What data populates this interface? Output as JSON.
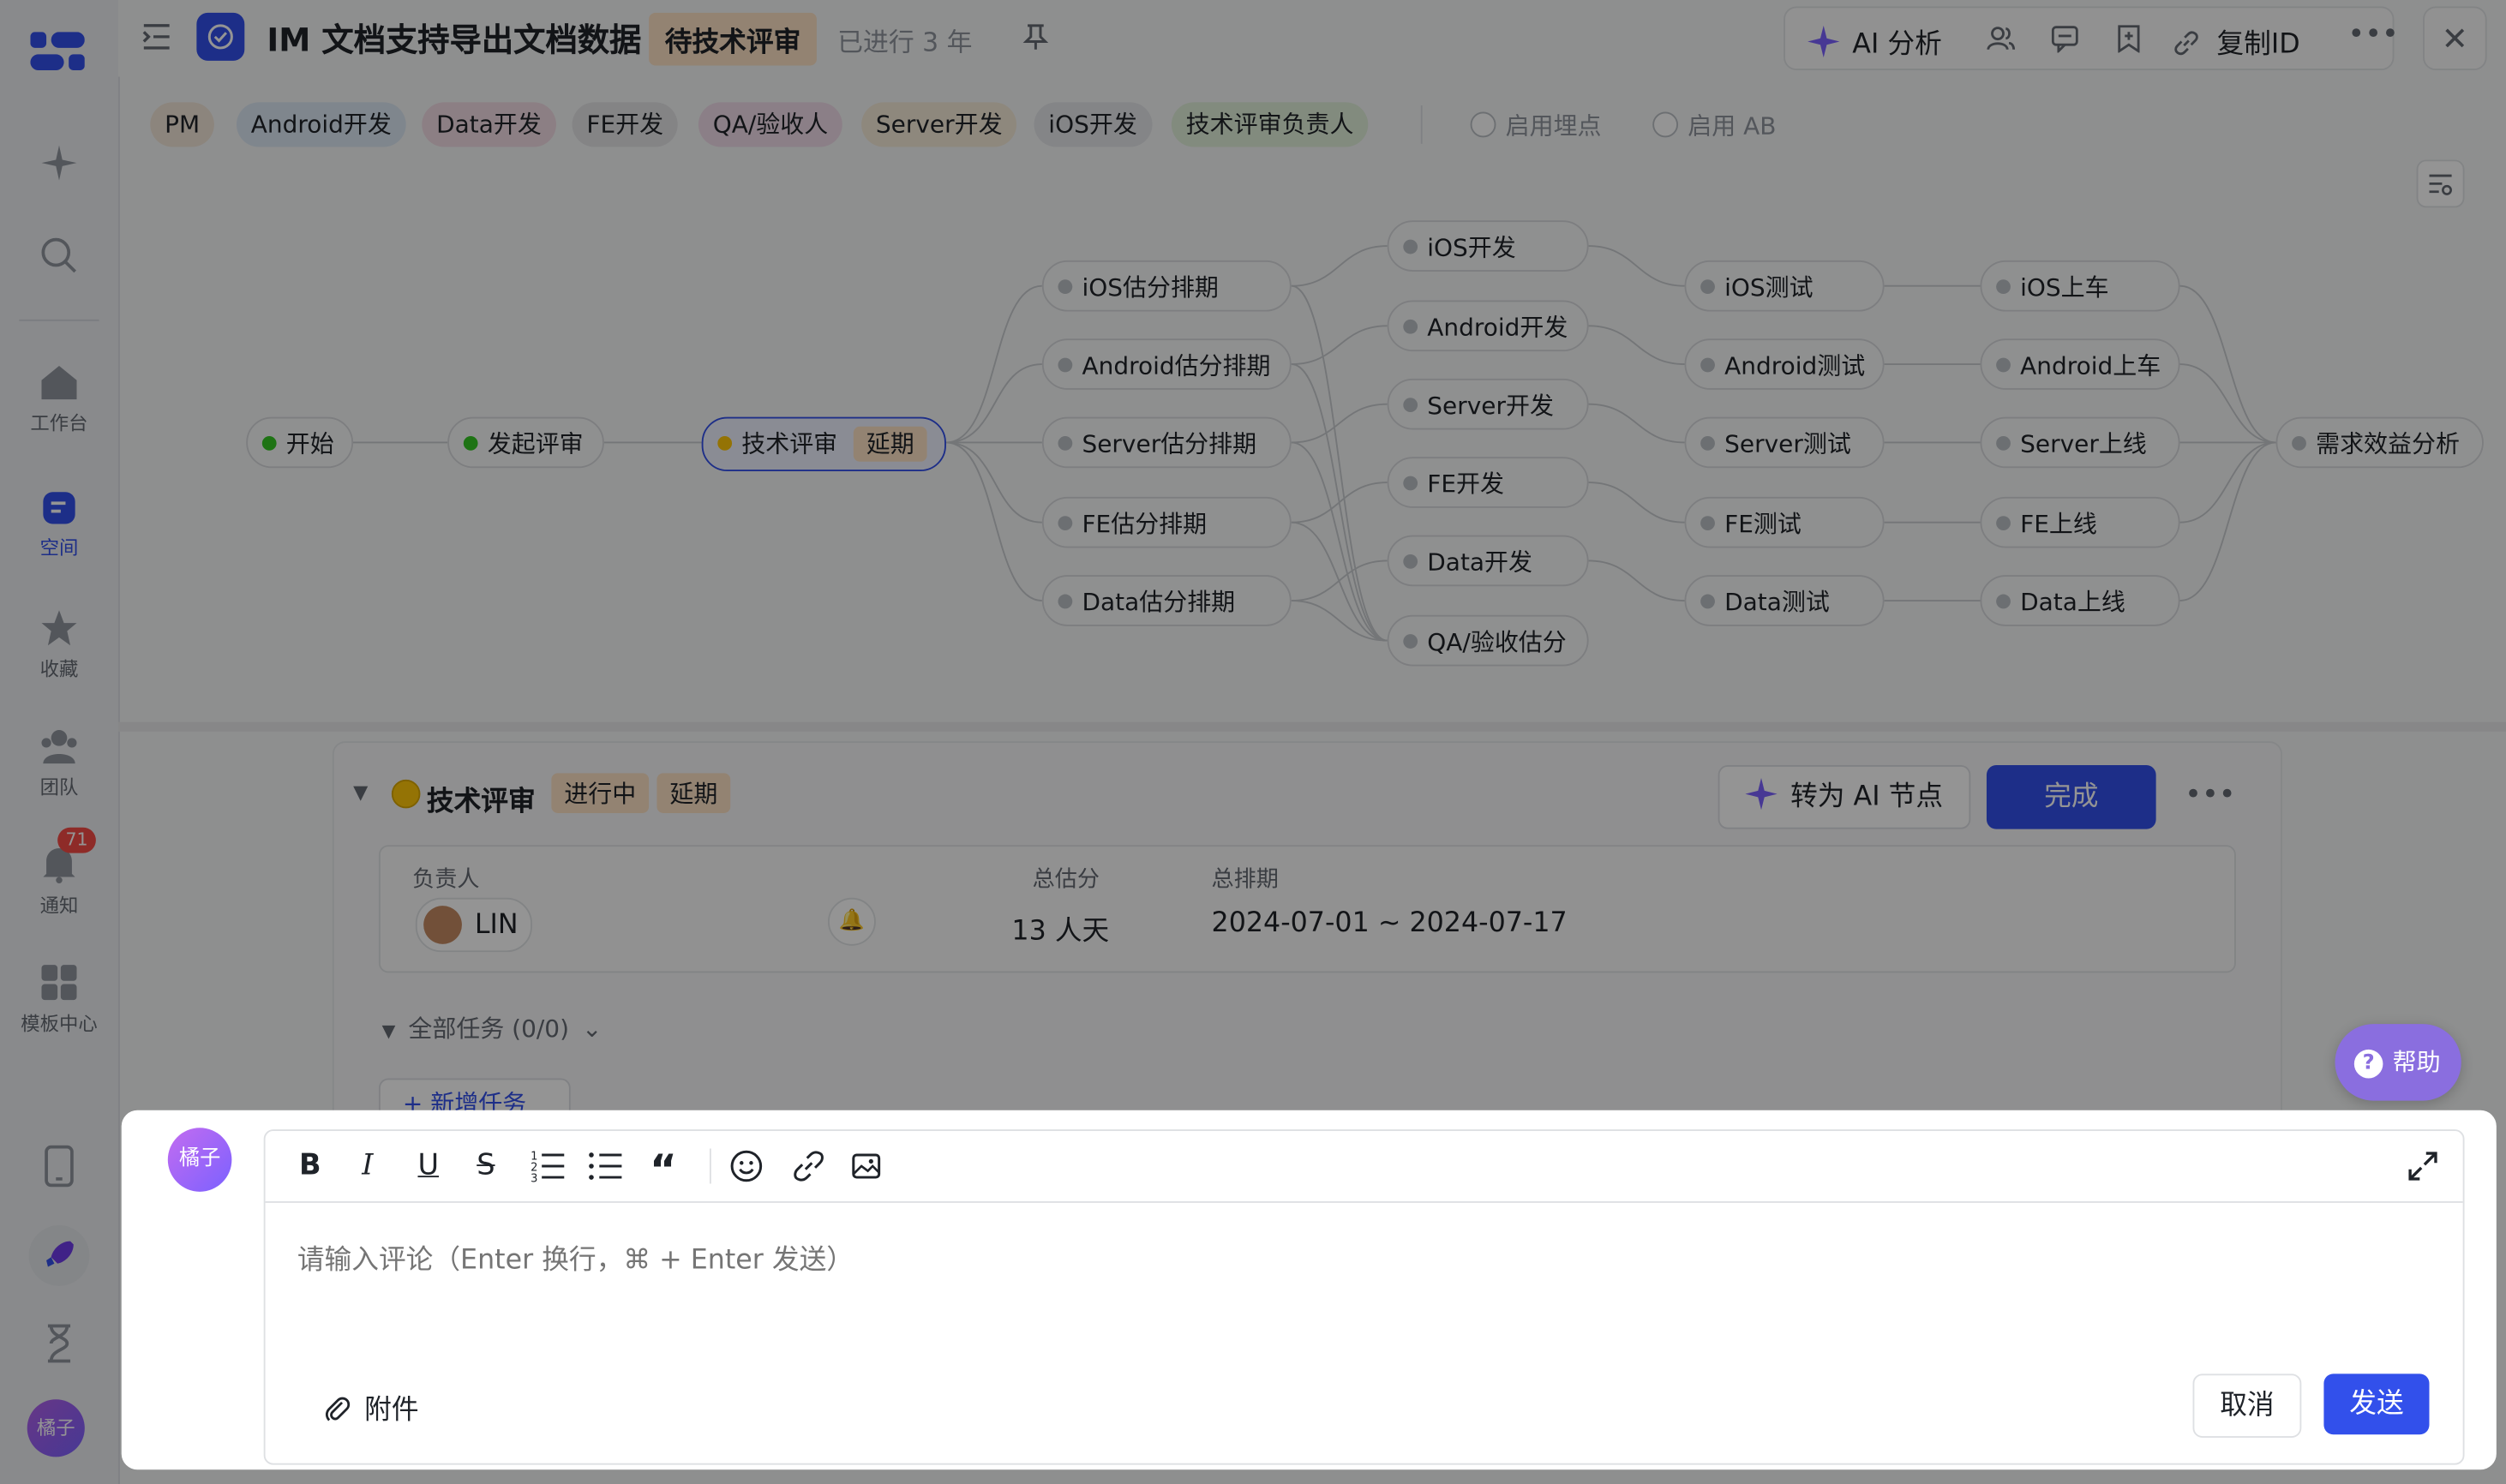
{
  "header": {
    "title": "IM 文档支持导出文档数据",
    "status": "待技术评审",
    "elapsed": "已进行 3 年",
    "pin_icon": "pin-icon",
    "toolbar": {
      "ai_label": "AI 分析",
      "copy_id_label": "复制ID"
    }
  },
  "left_nav": {
    "items": [
      {
        "label": "工作台"
      },
      {
        "label": "空间"
      },
      {
        "label": "收藏"
      },
      {
        "label": "团队"
      },
      {
        "label": "通知",
        "badge": "71"
      },
      {
        "label": "模板中心"
      }
    ],
    "user_avatar": "橘子"
  },
  "role_tags": [
    {
      "label": "PM",
      "color": "#f2e6d8"
    },
    {
      "label": "Android开发",
      "color": "#dbe7f3"
    },
    {
      "label": "Data开发",
      "color": "#f2dbe3"
    },
    {
      "label": "FE开发",
      "color": "#e3e3e6"
    },
    {
      "label": "QA/验收人",
      "color": "#efdbe8"
    },
    {
      "label": "Server开发",
      "color": "#f4ead8"
    },
    {
      "label": "iOS开发",
      "color": "#e3e5e8"
    },
    {
      "label": "技术评审负责人",
      "color": "#e0efd9"
    }
  ],
  "toggles": {
    "tracking": "启用埋点",
    "ab": "启用 AB"
  },
  "flow": {
    "start": "开始",
    "initiate": "发起评审",
    "tech_review": "技术评审",
    "tech_review_tag": "延期",
    "estimates": [
      "iOS估分排期",
      "Android估分排期",
      "Server估分排期",
      "FE估分排期",
      "Data估分排期"
    ],
    "dev": [
      "iOS开发",
      "Android开发",
      "Server开发",
      "FE开发",
      "Data开发",
      "QA/验收估分"
    ],
    "test": [
      "iOS测试",
      "Android测试",
      "Server测试",
      "FE测试",
      "Data测试"
    ],
    "release": [
      "iOS上车",
      "Android上车",
      "Server上线",
      "FE上线",
      "Data上线"
    ],
    "final": "需求效益分析"
  },
  "detail": {
    "title": "技术评审",
    "state": "进行中",
    "tag": "延期",
    "ai_button": "转为 AI 节点",
    "done_button": "完成",
    "owner_label": "负责人",
    "owner_name": "LIN",
    "estimate_label": "总估分",
    "estimate_value": "13 人天",
    "schedule_label": "总排期",
    "schedule_value": "2024-07-01 ~ 2024-07-17",
    "tasks_summary": "全部任务 (0/0)",
    "add_task": "+ 新增任务"
  },
  "help": {
    "label": "帮助"
  },
  "comment": {
    "avatar": "橘子",
    "placeholder": "请输入评论（Enter 换行，⌘ + Enter 发送）",
    "attach_label": "附件",
    "cancel_label": "取消",
    "send_label": "发送"
  },
  "colors": {
    "primary": "#3250eb",
    "status_orange": "#fde2c5",
    "ai_purple": "#7b61ff"
  }
}
